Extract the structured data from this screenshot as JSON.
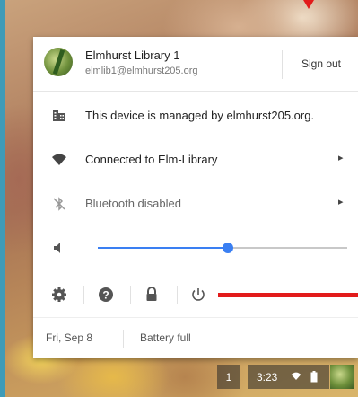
{
  "user": {
    "name": "Elmhurst Library 1",
    "email": "elmlib1@elmhurst205.org",
    "sign_out_label": "Sign out"
  },
  "rows": {
    "managed": "This device is managed by elmhurst205.org.",
    "network": "Connected to Elm-Library",
    "bluetooth": "Bluetooth disabled"
  },
  "volume": {
    "level": 0.52
  },
  "footer": {
    "date": "Fri, Sep 8",
    "battery": "Battery full"
  },
  "shelf": {
    "desk_number": "1",
    "time": "3:23"
  },
  "colors": {
    "accent": "#3a7ff2",
    "annotation_red": "#e21b1b",
    "wallpaper_border": "#3f9bb7"
  },
  "icons": {
    "managed": "building-icon",
    "network": "wifi-icon",
    "bluetooth": "bluetooth-disabled-icon",
    "volume": "speaker-icon",
    "settings": "gear-icon",
    "help": "help-icon",
    "lock": "lock-icon",
    "power": "power-icon"
  }
}
